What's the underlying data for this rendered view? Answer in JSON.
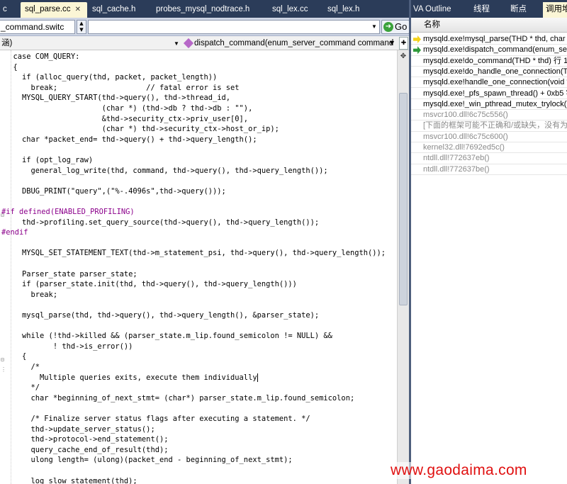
{
  "tabs": [
    {
      "label": "c",
      "active": false
    },
    {
      "label": "sql_parse.cc",
      "active": true
    },
    {
      "label": "sql_cache.h",
      "active": false
    },
    {
      "label": "probes_mysql_nodtrace.h",
      "active": false
    },
    {
      "label": "sql_lex.cc",
      "active": false
    },
    {
      "label": "sql_lex.h",
      "active": false
    }
  ],
  "combo": {
    "value": "_command.switc",
    "go_label": "Go"
  },
  "nav": {
    "left": "涵)",
    "right": "dispatch_command(enum_server_command command"
  },
  "code_lines": [
    "  case COM_QUERY:",
    "  {",
    "    if (alloc_query(thd, packet, packet_length))",
    "      break;                    // fatal error is set",
    "    MYSQL_QUERY_START(thd->query(), thd->thread_id,",
    "                      (char *) (thd->db ? thd->db : \"\"),",
    "                      &thd->security_ctx->priv_user[0],",
    "                      (char *) thd->security_ctx->host_or_ip);",
    "    char *packet_end= thd->query() + thd->query_length();",
    "",
    "    if (opt_log_raw)",
    "      general_log_write(thd, command, thd->query(), thd->query_length());",
    "",
    "    DBUG_PRINT(\"query\",(\"%-.4096s\",thd->query()));",
    "",
    "#if defined(ENABLED_PROFILING)",
    "    thd->profiling.set_query_source(thd->query(), thd->query_length());",
    "#endif",
    "",
    "    MYSQL_SET_STATEMENT_TEXT(thd->m_statement_psi, thd->query(), thd->query_length());",
    "",
    "    Parser_state parser_state;",
    "    if (parser_state.init(thd, thd->query(), thd->query_length()))",
    "      break;",
    "",
    "    mysql_parse(thd, thd->query(), thd->query_length(), &parser_state);",
    "",
    "    while (!thd->killed && (parser_state.m_lip.found_semicolon != NULL) &&",
    "           ! thd->is_error())",
    "    {",
    "      /*",
    "        Multiple queries exits, execute them individually",
    "      */",
    "      char *beginning_of_next_stmt= (char*) parser_state.m_lip.found_semicolon;",
    "",
    "      /* Finalize server status flags after executing a statement. */",
    "      thd->update_server_status();",
    "      thd->protocol->end_statement();",
    "      query_cache_end_of_result(thd);",
    "      ulong length= (ulong)(packet_end - beginning_of_next_stmt);",
    "",
    "      log_slow_statement(thd);"
  ],
  "right_tabs": [
    {
      "label": "VA Outline",
      "active": false
    },
    {
      "label": "线程",
      "active": false
    },
    {
      "label": "断点",
      "active": false
    },
    {
      "label": "调用堆",
      "active": true
    }
  ],
  "callstack": {
    "header": "名称",
    "rows": [
      {
        "text": "mysqld.exe!mysql_parse(THD * thd, char * ",
        "marker": "yellow",
        "gray": false
      },
      {
        "text": "mysqld.exe!dispatch_command(enum_ser",
        "marker": "green",
        "gray": false
      },
      {
        "text": "mysqld.exe!do_command(THD * thd)  行 1",
        "marker": "",
        "gray": false
      },
      {
        "text": "mysqld.exe!do_handle_one_connection(Th",
        "marker": "",
        "gray": false
      },
      {
        "text": "mysqld.exe!handle_one_connection(void *",
        "marker": "",
        "gray": false
      },
      {
        "text": "mysqld.exe!_pfs_spawn_thread()  + 0xb5 字",
        "marker": "",
        "gray": false
      },
      {
        "text": "mysqld.exe!_win_pthread_mutex_trylock()",
        "marker": "",
        "gray": false
      },
      {
        "text": "msvcr100.dll!6c75c556()",
        "marker": "",
        "gray": true
      },
      {
        "text": "[下面的框架可能不正确和/或缺失，没有为",
        "marker": "",
        "gray": true
      },
      {
        "text": "msvcr100.dll!6c75c600()",
        "marker": "",
        "gray": true
      },
      {
        "text": "kernel32.dll!7692ed5c()",
        "marker": "",
        "gray": true
      },
      {
        "text": "ntdll.dll!772637eb()",
        "marker": "",
        "gray": true
      },
      {
        "text": "ntdll.dll!772637be()",
        "marker": "",
        "gray": true
      }
    ]
  },
  "watermark": "www.gaodaima.com"
}
